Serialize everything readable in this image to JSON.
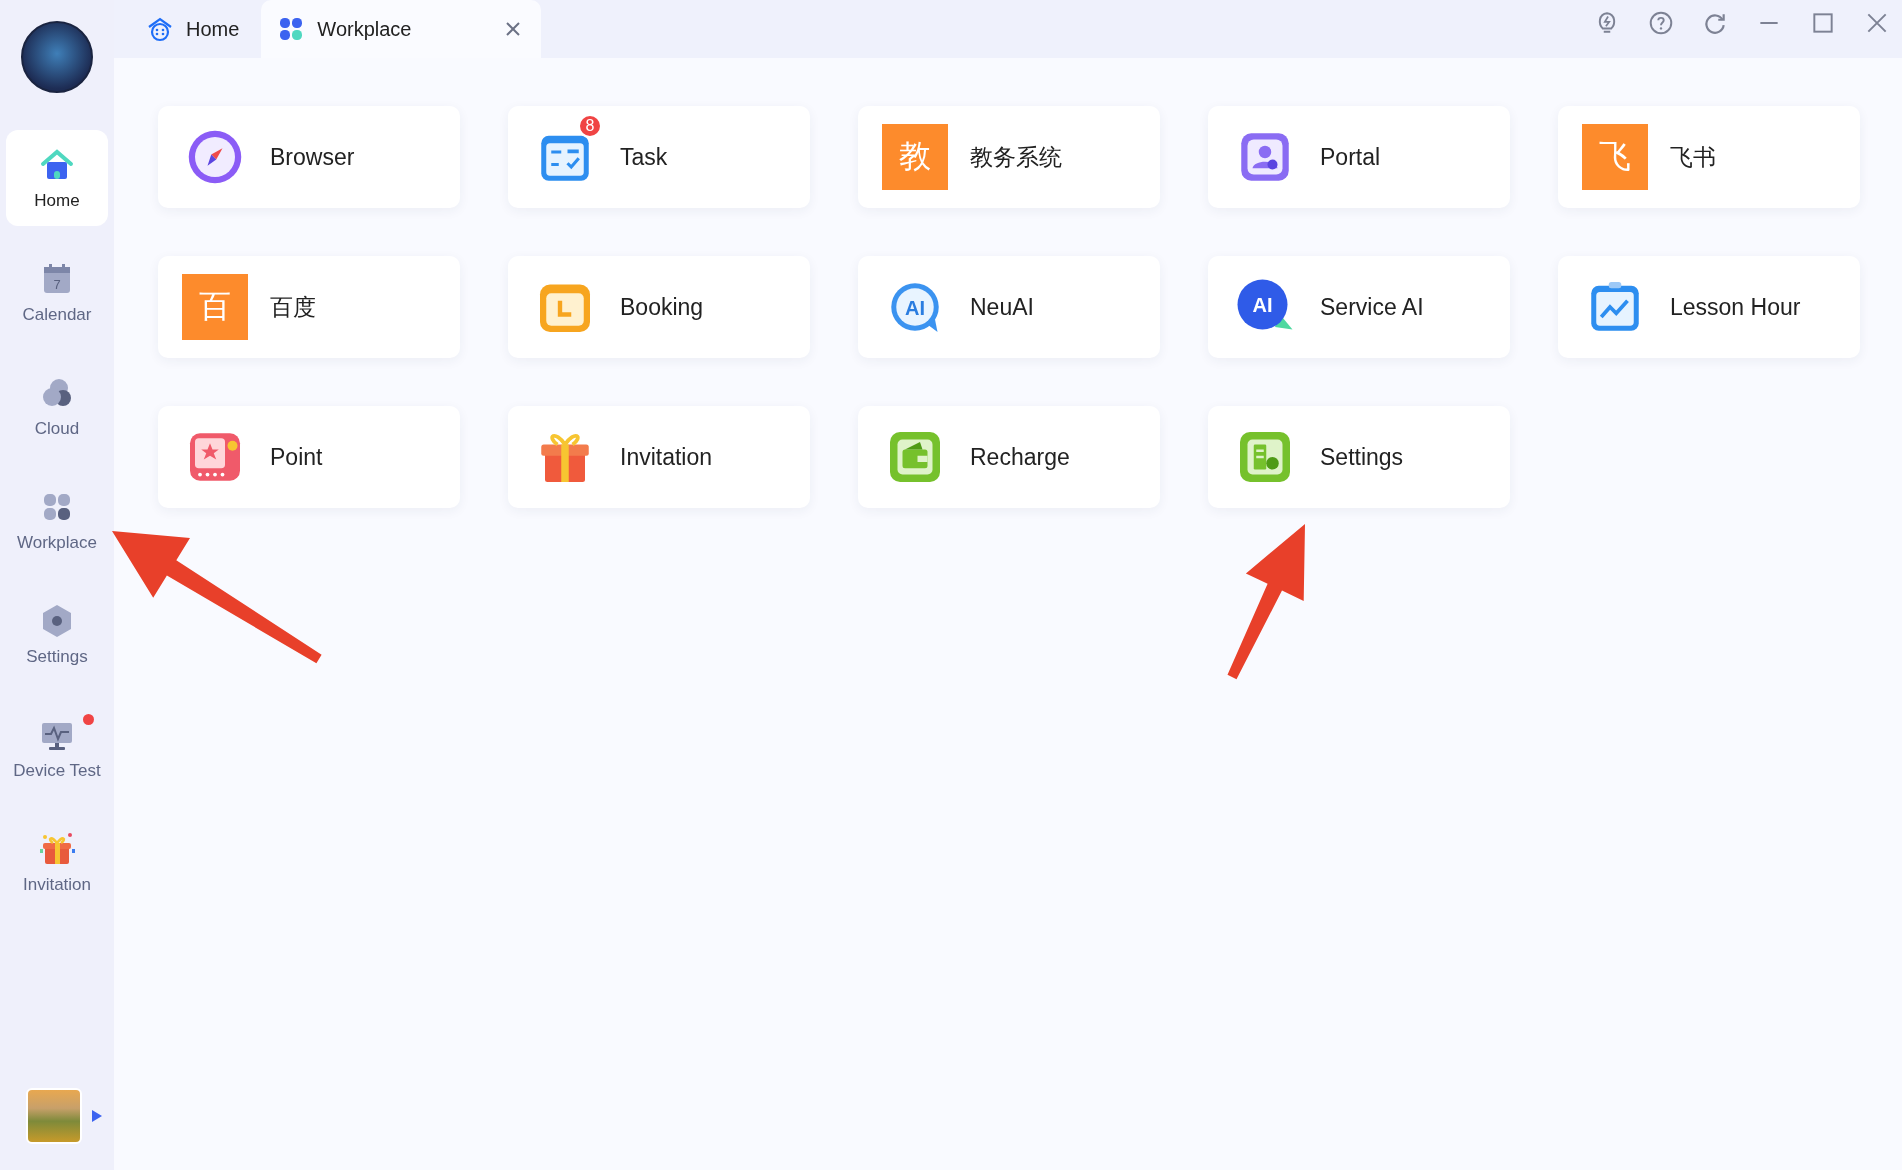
{
  "tabs": [
    {
      "label": "Home",
      "selected": false,
      "closable": false
    },
    {
      "label": "Workplace",
      "selected": true,
      "closable": true
    }
  ],
  "sidebar": {
    "items": [
      {
        "label": "Home",
        "selected": true,
        "notification": false
      },
      {
        "label": "Calendar",
        "selected": false,
        "notification": false,
        "icon_text": "7"
      },
      {
        "label": "Cloud",
        "selected": false,
        "notification": false
      },
      {
        "label": "Workplace",
        "selected": false,
        "notification": false
      },
      {
        "label": "Settings",
        "selected": false,
        "notification": false
      },
      {
        "label": "Device Test",
        "selected": false,
        "notification": true
      },
      {
        "label": "Invitation",
        "selected": false,
        "notification": false
      }
    ]
  },
  "apps": [
    {
      "label": "Browser",
      "kind": "icon"
    },
    {
      "label": "Task",
      "kind": "icon",
      "badge": "8"
    },
    {
      "label": "教务系统",
      "kind": "tile",
      "tile_text": "教"
    },
    {
      "label": "Portal",
      "kind": "icon"
    },
    {
      "label": "飞书",
      "kind": "tile",
      "tile_text": "飞"
    },
    {
      "label": "百度",
      "kind": "tile",
      "tile_text": "百"
    },
    {
      "label": "Booking",
      "kind": "icon"
    },
    {
      "label": "NeuAI",
      "kind": "icon",
      "icon_text": "AI"
    },
    {
      "label": "Service AI",
      "kind": "icon",
      "icon_text": "AI"
    },
    {
      "label": "Lesson Hour",
      "kind": "icon"
    },
    {
      "label": "Point",
      "kind": "icon"
    },
    {
      "label": "Invitation",
      "kind": "icon"
    },
    {
      "label": "Recharge",
      "kind": "icon"
    },
    {
      "label": "Settings",
      "kind": "icon"
    }
  ]
}
